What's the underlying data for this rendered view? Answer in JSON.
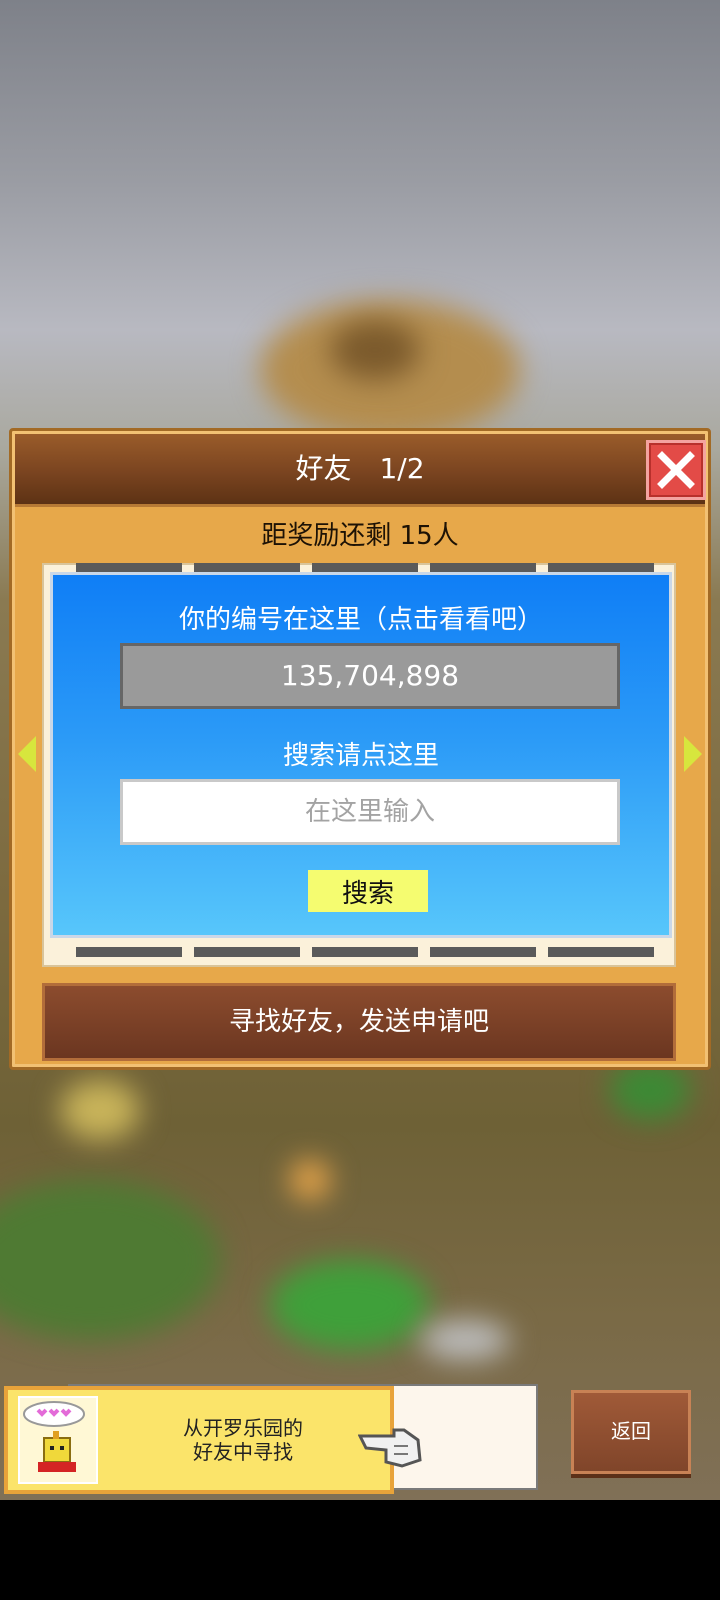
{
  "dialog": {
    "title": "好友　1/2",
    "reward_text": "距奖励还剩 15人",
    "my_id_label": "你的编号在这里（点击看看吧）",
    "my_id_value": "135,704,898",
    "search_label": "搜索请点这里",
    "search_placeholder": "在这里输入",
    "search_button": "搜索",
    "find_friends_button": "寻找好友，发送申请吧"
  },
  "banner": {
    "text_line1": "从开罗乐园的",
    "text_line2": "好友中寻找"
  },
  "back_button": "返回",
  "icons": {
    "close": "close-icon",
    "arrow_left": "arrow-left-icon",
    "arrow_right": "arrow-right-icon",
    "hand": "pointing-hand-icon",
    "avatar": "kairobot-avatar"
  },
  "colors": {
    "panel_blue": "#1a88f7",
    "search_button": "#f5fc70",
    "close_red": "#e34b47",
    "dialog_gold": "#e7a84a"
  }
}
